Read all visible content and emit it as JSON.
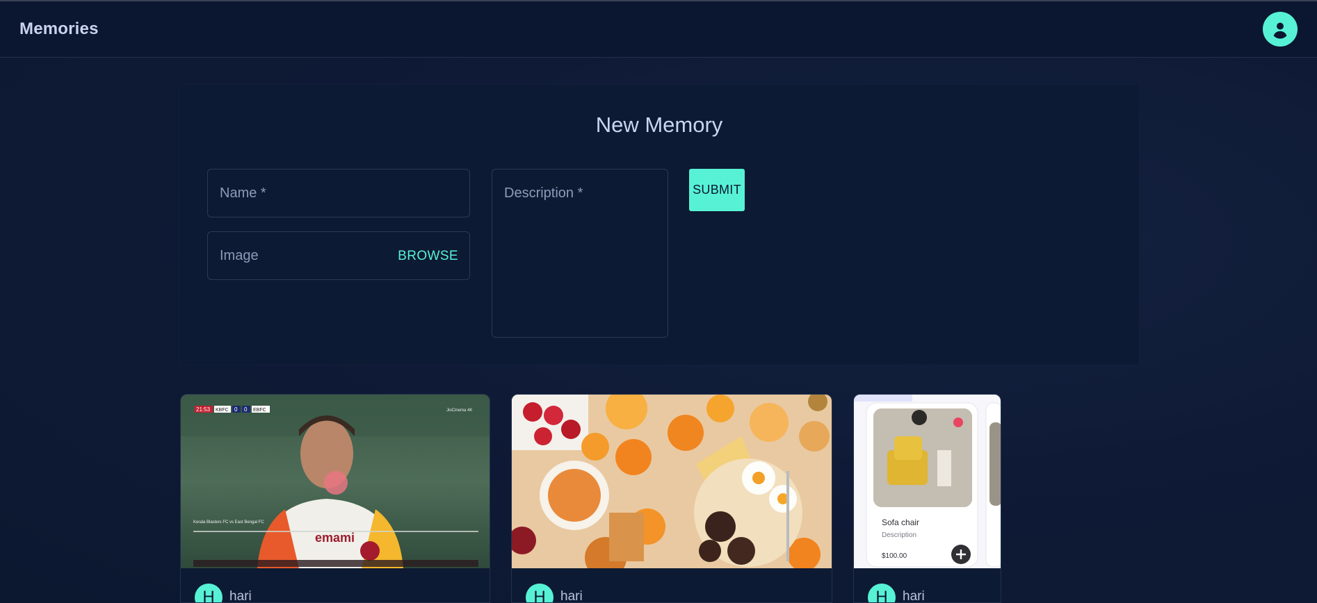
{
  "app": {
    "title": "Memories"
  },
  "header": {
    "account_icon": "account-circle-icon"
  },
  "form": {
    "title": "New Memory",
    "name_placeholder": "Name *",
    "image_label": "Image",
    "browse_label": "BROWSE",
    "description_placeholder": "Description *",
    "submit_label": "SUBMIT"
  },
  "cards": [
    {
      "author_initial": "H",
      "author": "hari",
      "image_desc": "football-match-screenshot",
      "overlay": {
        "clock": "21:53",
        "home": "KBFC",
        "home_score": "0",
        "away_score": "0",
        "away": "EBFC",
        "broadcaster": "JioCinema 4K",
        "match_title": "Kerala Blasters FC vs East Bengal FC",
        "sponsor": "emami"
      }
    },
    {
      "author_initial": "H",
      "author": "hari",
      "image_desc": "breakfast-food-photo"
    },
    {
      "author_initial": "H",
      "author": "hari",
      "image_desc": "sofa-chair-product-card",
      "product": {
        "name": "Sofa chair",
        "description": "Description",
        "price": "$100.00"
      }
    }
  ],
  "colors": {
    "accent": "#57f2d6",
    "background": "#0f1b34",
    "appbar": "#0b1730"
  }
}
